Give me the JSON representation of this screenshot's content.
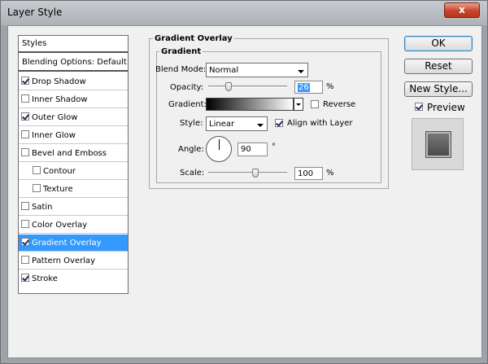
{
  "window": {
    "title": "Layer Style",
    "close_glyph": "x"
  },
  "styles_panel": {
    "header": "Styles",
    "blending_options": "Blending Options: Default",
    "items": [
      {
        "label": "Drop Shadow",
        "checked": true,
        "indent": false,
        "selected": false
      },
      {
        "label": "Inner Shadow",
        "checked": false,
        "indent": false,
        "selected": false
      },
      {
        "label": "Outer Glow",
        "checked": true,
        "indent": false,
        "selected": false
      },
      {
        "label": "Inner Glow",
        "checked": false,
        "indent": false,
        "selected": false
      },
      {
        "label": "Bevel and Emboss",
        "checked": false,
        "indent": false,
        "selected": false
      },
      {
        "label": "Contour",
        "checked": false,
        "indent": true,
        "selected": false
      },
      {
        "label": "Texture",
        "checked": false,
        "indent": true,
        "selected": false
      },
      {
        "label": "Satin",
        "checked": false,
        "indent": false,
        "selected": false
      },
      {
        "label": "Color Overlay",
        "checked": false,
        "indent": false,
        "selected": false
      },
      {
        "label": "Gradient Overlay",
        "checked": true,
        "indent": false,
        "selected": true
      },
      {
        "label": "Pattern Overlay",
        "checked": false,
        "indent": false,
        "selected": false
      },
      {
        "label": "Stroke",
        "checked": true,
        "indent": false,
        "selected": false
      }
    ]
  },
  "gradient_overlay": {
    "group_title": "Gradient Overlay",
    "subgroup_title": "Gradient",
    "blend_mode": {
      "label": "Blend Mode:",
      "value": "Normal"
    },
    "opacity": {
      "label": "Opacity:",
      "value": "26",
      "unit": "%",
      "slider_level": 0.26
    },
    "gradient": {
      "label": "Gradient:",
      "start_color": "#000000",
      "end_color": "#ffffff"
    },
    "reverse": {
      "label": "Reverse",
      "checked": false
    },
    "style": {
      "label": "Style:",
      "value": "Linear"
    },
    "align_with_layer": {
      "label": "Align with Layer",
      "checked": true
    },
    "angle": {
      "label": "Angle:",
      "value": "90",
      "unit": "°"
    },
    "scale": {
      "label": "Scale:",
      "value": "100",
      "unit": "%",
      "slider_level": 0.6
    }
  },
  "buttons": {
    "ok": "OK",
    "reset": "Reset",
    "new_style": "New Style...",
    "preview_label": "Preview",
    "preview_checked": true
  },
  "colors": {
    "selection": "#3399ff",
    "dialog_bg": "#f0f0f0",
    "close_button": "#c7442a"
  }
}
